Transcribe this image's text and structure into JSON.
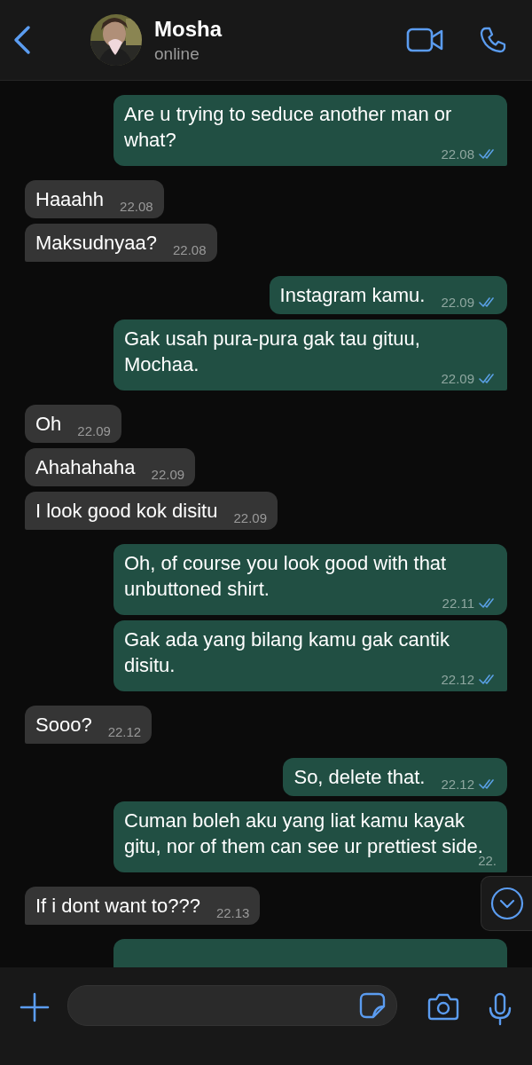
{
  "header": {
    "name": "Mosha",
    "status": "online"
  },
  "messages": [
    {
      "kind": "out",
      "text": "Are u trying to seduce another man or what?",
      "time": "22.08",
      "read": true,
      "tail": true
    },
    {
      "kind": "in",
      "text": "Haaahh",
      "time": "22.08",
      "tail": false
    },
    {
      "kind": "in",
      "text": "Maksudnyaa?",
      "time": "22.08",
      "tail": true
    },
    {
      "kind": "out",
      "text": "Instagram kamu.",
      "time": "22.09",
      "read": true,
      "tail": false
    },
    {
      "kind": "out",
      "text": "Gak usah pura-pura gak tau gituu, Mochaa.",
      "time": "22.09",
      "read": true,
      "tail": true
    },
    {
      "kind": "in",
      "text": "Oh",
      "time": "22.09",
      "tail": false
    },
    {
      "kind": "in",
      "text": "Ahahahaha",
      "time": "22.09",
      "tail": false
    },
    {
      "kind": "in",
      "text": "I look good kok disitu",
      "time": "22.09",
      "tail": true
    },
    {
      "kind": "out",
      "text": "Oh, of course you look good with that unbuttoned shirt.",
      "time": "22.11",
      "read": true,
      "tail": false
    },
    {
      "kind": "out",
      "text": "Gak ada yang bilang kamu gak cantik disitu.",
      "time": "22.12",
      "read": true,
      "tail": true
    },
    {
      "kind": "in",
      "text": "Sooo?",
      "time": "22.12",
      "tail": true
    },
    {
      "kind": "out",
      "text": "So, delete that.",
      "time": "22.12",
      "read": true,
      "tail": false
    },
    {
      "kind": "out",
      "text": "Cuman boleh aku yang liat kamu kayak gitu, nor of them can see ur prettiest side.",
      "time": "22.",
      "tail": true
    },
    {
      "kind": "in",
      "text": "If i dont want to???",
      "time": "22.13",
      "tail": true
    },
    {
      "kind": "out"
    }
  ]
}
